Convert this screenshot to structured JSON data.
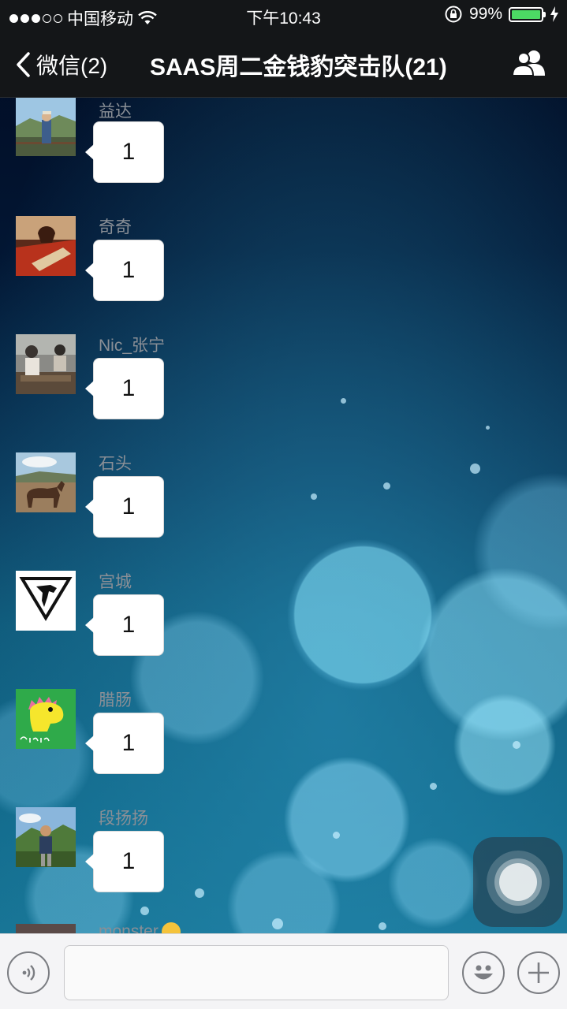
{
  "status_bar": {
    "carrier": "中国移动",
    "time": "下午10:43",
    "battery_percent": "99%",
    "battery_level": 0.99,
    "signal_bars_filled": 3,
    "signal_bars_total": 5
  },
  "nav": {
    "back_label": "微信(2)",
    "title": "SAAS周二金钱豹突击队(21)"
  },
  "messages": [
    {
      "sender": "益达",
      "text": "1"
    },
    {
      "sender": "奇奇",
      "text": "1"
    },
    {
      "sender": "Nic_张宁",
      "text": "1"
    },
    {
      "sender": "石头",
      "text": "1"
    },
    {
      "sender": "宫城",
      "text": "1"
    },
    {
      "sender": "腊肠",
      "text": "1"
    },
    {
      "sender": "段扬扬",
      "text": "1"
    },
    {
      "sender": "monster",
      "text": ""
    }
  ],
  "input_bar": {
    "placeholder": "",
    "value": ""
  },
  "colors": {
    "bar_bg": "#141618",
    "battery_green": "#4cd964",
    "bubble_bg": "#ffffff",
    "sender_text": "#8a8f96"
  }
}
